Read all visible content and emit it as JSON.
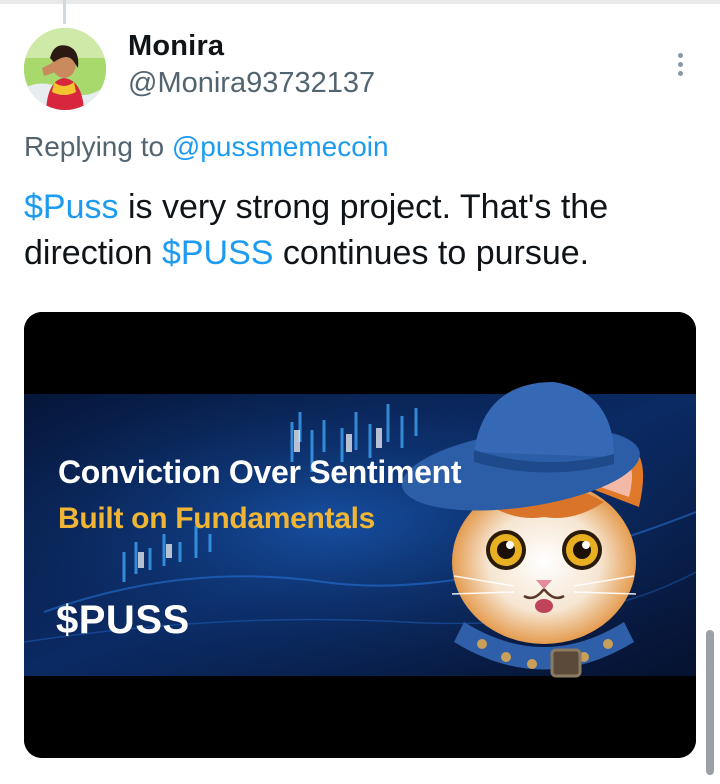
{
  "tweet": {
    "author": {
      "display_name": "Monira",
      "handle": "@Monira93732137"
    },
    "replying": {
      "prefix": "Replying to",
      "target": "@pussmemecoin"
    },
    "text": {
      "cashtag1": "$Puss",
      "part1": " is very strong project. That's the direction ",
      "cashtag2": "$PUSS",
      "part2": " continues to pursue."
    },
    "media": {
      "title": "Conviction Over Sentiment",
      "subtitle": "Built on Fundamentals",
      "ticker": "$PUSS"
    }
  },
  "colors": {
    "link": "#1d9bf0",
    "subtitle_gold": "#f0b534",
    "media_bg": "#0a1a3a"
  },
  "icons": {
    "more": "more-vertical-icon"
  }
}
